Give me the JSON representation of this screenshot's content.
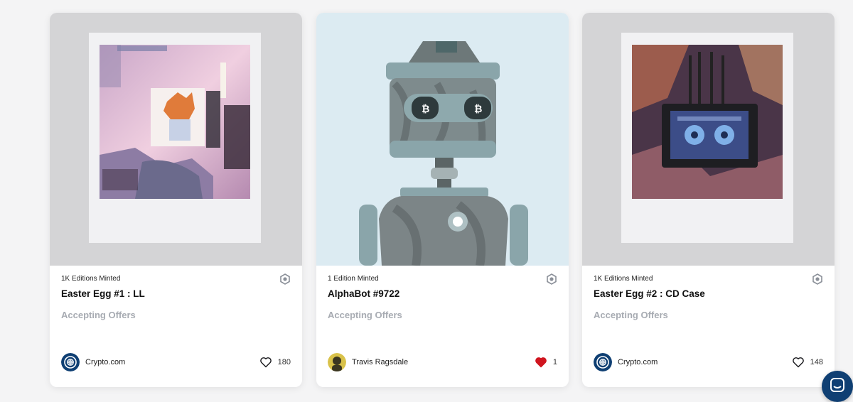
{
  "cards": [
    {
      "editions": "1K Editions Minted",
      "title": "Easter Egg #1 : LL",
      "status": "Accepting Offers",
      "creator": "Crypto.com",
      "creator_avatar": "crypto-com-logo",
      "likes": "180",
      "liked": false,
      "badge_icon": "hexagon-badge-icon"
    },
    {
      "editions": "1 Edition Minted",
      "title": "AlphaBot #9722",
      "status": "Accepting Offers",
      "creator": "Travis Ragsdale",
      "creator_avatar": "travis-ragsdale-avatar",
      "likes": "1",
      "liked": true,
      "badge_icon": "hexagon-badge-icon"
    },
    {
      "editions": "1K Editions Minted",
      "title": "Easter Egg #2 : CD Case",
      "status": "Accepting Offers",
      "creator": "Crypto.com",
      "creator_avatar": "crypto-com-logo",
      "likes": "148",
      "liked": false,
      "badge_icon": "hexagon-badge-icon"
    }
  ],
  "colors": {
    "accent_navy": "#0f3f73",
    "liked_red": "#d0151f",
    "muted_status": "#a7abb2"
  },
  "chat_widget_icon": "chat-icon"
}
